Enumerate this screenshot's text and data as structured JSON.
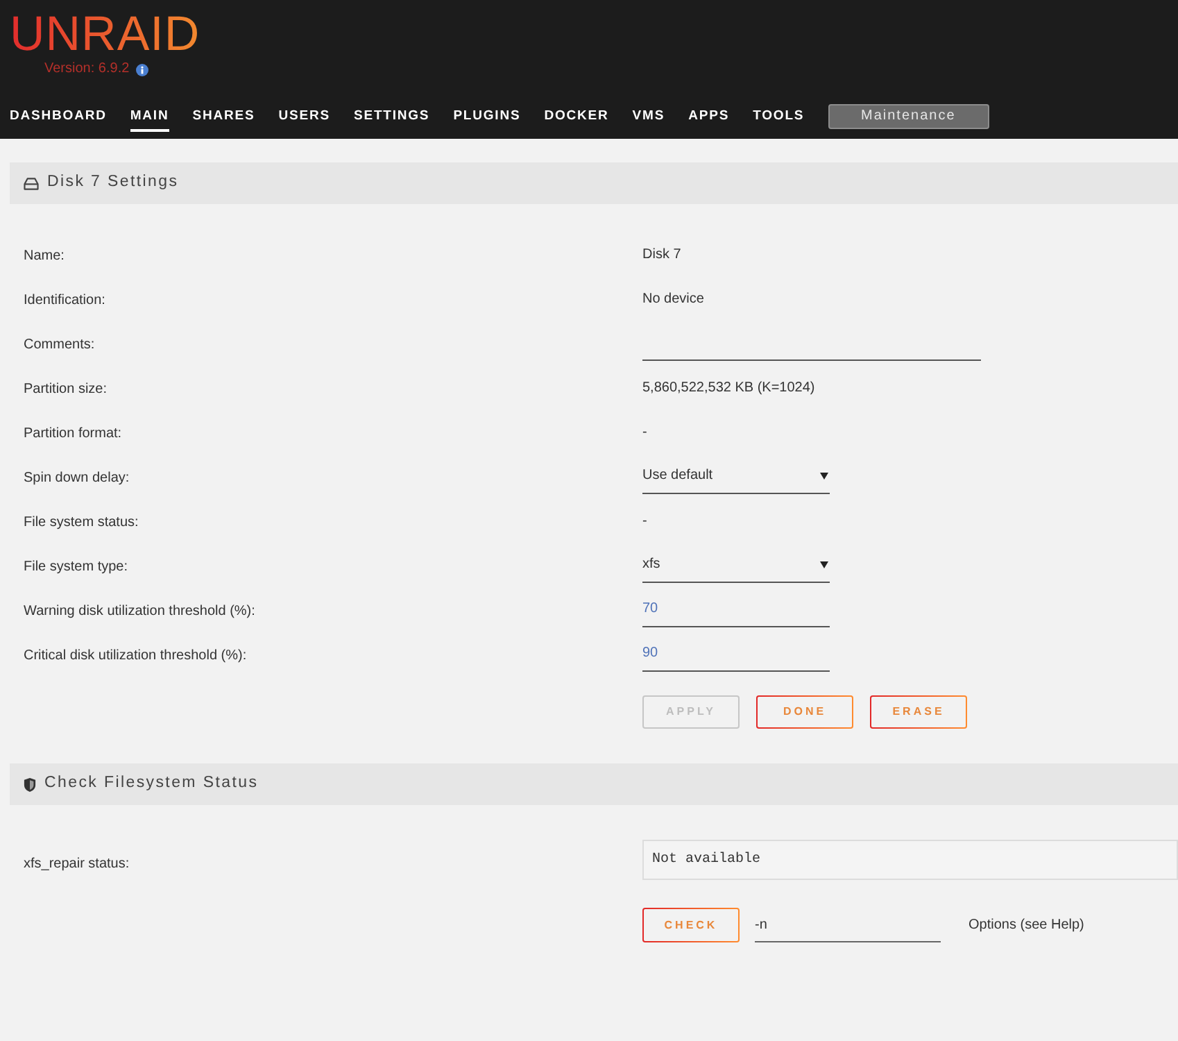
{
  "header": {
    "logo": "UNRAID",
    "version": "Version: 6.9.2"
  },
  "nav": {
    "tabs": [
      {
        "label": "DASHBOARD",
        "selected": false
      },
      {
        "label": "MAIN",
        "selected": true
      },
      {
        "label": "SHARES",
        "selected": false
      },
      {
        "label": "USERS",
        "selected": false
      },
      {
        "label": "SETTINGS",
        "selected": false
      },
      {
        "label": "PLUGINS",
        "selected": false
      },
      {
        "label": "DOCKER",
        "selected": false
      },
      {
        "label": "VMS",
        "selected": false
      },
      {
        "label": "APPS",
        "selected": false
      },
      {
        "label": "TOOLS",
        "selected": false
      }
    ],
    "maintenance_button": "Maintenance"
  },
  "disk_settings": {
    "title": "Disk 7 Settings",
    "rows": [
      {
        "label": "Name:",
        "kind": "text",
        "value": "Disk 7"
      },
      {
        "label": "Identification:",
        "kind": "text",
        "value": "No device"
      },
      {
        "label": "Comments:",
        "kind": "text_input"
      },
      {
        "label": "Partition size:",
        "kind": "text",
        "value": "5,860,522,532 KB (K=1024)"
      },
      {
        "label": "Partition format:",
        "kind": "text",
        "value": "-"
      },
      {
        "label": "Spin down delay:",
        "kind": "select",
        "value": "Use default"
      },
      {
        "label": "File system status:",
        "kind": "text",
        "value": "-"
      },
      {
        "label": "File system type:",
        "kind": "select",
        "value": "xfs"
      },
      {
        "label": "Warning disk utilization threshold (%):",
        "kind": "number_input",
        "value": "70"
      },
      {
        "label": "Critical disk utilization threshold (%):",
        "kind": "number_input",
        "value": "90"
      }
    ],
    "buttons": [
      {
        "label": "APPLY",
        "disabled": true
      },
      {
        "label": "DONE",
        "disabled": false
      },
      {
        "label": "ERASE",
        "disabled": false
      }
    ]
  },
  "check_filesystem": {
    "title": "Check Filesystem Status",
    "status_label": "xfs_repair status:",
    "status_output": "Not available",
    "check_button": "CHECK",
    "options_field": {
      "value": "-n"
    },
    "options_note": "Options (see Help)"
  }
}
